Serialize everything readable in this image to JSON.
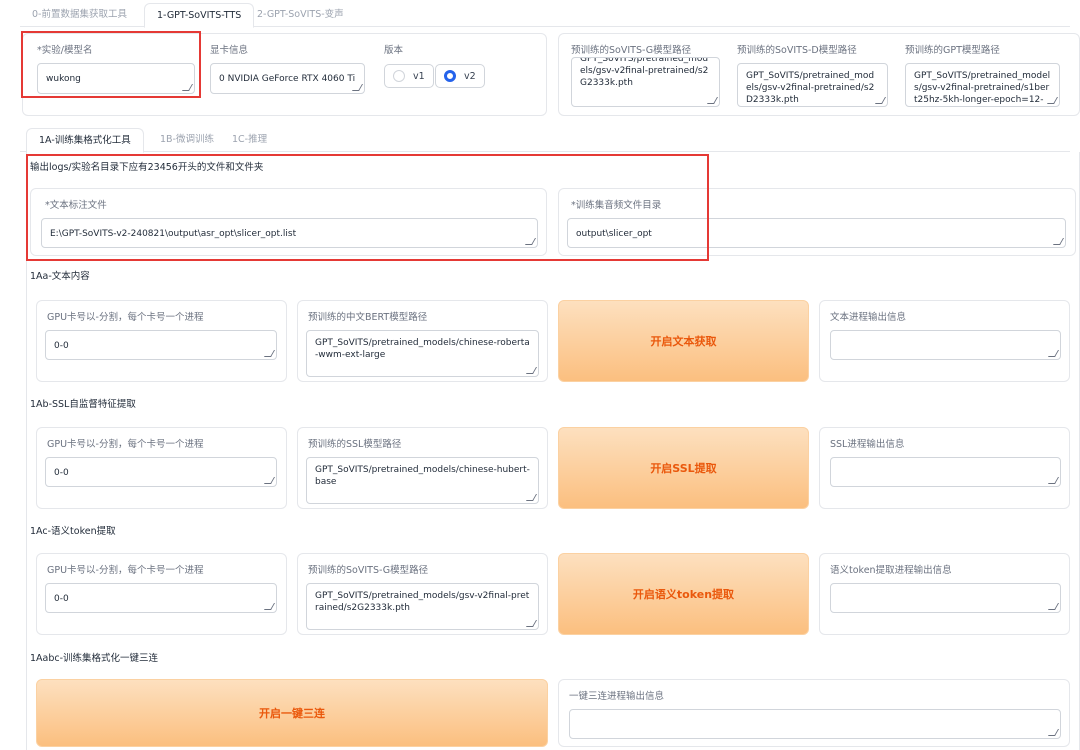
{
  "top_tabs": [
    "0-前置数据集获取工具",
    "1-GPT-SoVITS-TTS",
    "2-GPT-SoVITS-变声"
  ],
  "settings": {
    "exp_name_label": "*实验/模型名",
    "exp_name_value": "wukong",
    "gpu_info_label": "显卡信息",
    "gpu_info_value": "0 NVIDIA GeForce RTX 4060 Ti",
    "version_label": "版本",
    "version_options": [
      "v1",
      "v2"
    ],
    "version_selected": "v2",
    "sovits_g_label": "预训练的SoVITS-G模型路径",
    "sovits_g_value": "GPT_SoVITS/pretrained_models/gsv-v2final-pretrained/s2G2333k.pth",
    "sovits_d_label": "预训练的SoVITS-D模型路径",
    "sovits_d_value": "GPT_SoVITS/pretrained_models/gsv-v2final-pretrained/s2D2333k.pth",
    "gpt_label": "预训练的GPT模型路径",
    "gpt_value": "GPT_SoVITS/pretrained_models/gsv-v2final-pretrained/s1bert25hz-5kh-longer-epoch=12-"
  },
  "sub_tabs": [
    "1A-训练集格式化工具",
    "1B-微调训练",
    "1C-推理"
  ],
  "logs_hint": "输出logs/实验名目录下应有23456开头的文件和文件夹",
  "inputs": {
    "text_label": "*文本标注文件",
    "text_value": "E:\\GPT-SoVITS-v2-240821\\output\\asr_opt\\slicer_opt.list",
    "audio_dir_label": "*训练集音频文件目录",
    "audio_dir_value": "output\\slicer_opt"
  },
  "section_1aa": {
    "title": "1Aa-文本内容",
    "gpu_label": "GPU卡号以-分割，每个卡号一个进程",
    "gpu_value": "0-0",
    "bert_label": "预训练的中文BERT模型路径",
    "bert_value": "GPT_SoVITS/pretrained_models/chinese-roberta-wwm-ext-large",
    "button": "开启文本获取",
    "output_label": "文本进程输出信息",
    "output_value": ""
  },
  "section_1ab": {
    "title": "1Ab-SSL自监督特征提取",
    "gpu_label": "GPU卡号以-分割，每个卡号一个进程",
    "gpu_value": "0-0",
    "ssl_label": "预训练的SSL模型路径",
    "ssl_value": "GPT_SoVITS/pretrained_models/chinese-hubert-base",
    "button": "开启SSL提取",
    "output_label": "SSL进程输出信息",
    "output_value": ""
  },
  "section_1ac": {
    "title": "1Ac-语义token提取",
    "gpu_label": "GPU卡号以-分割，每个卡号一个进程",
    "gpu_value": "0-0",
    "model_label": "预训练的SoVITS-G模型路径",
    "model_value": "GPT_SoVITS/pretrained_models/gsv-v2final-pretrained/s2G2333k.pth",
    "button": "开启语义token提取",
    "output_label": "语义token提取进程输出信息",
    "output_value": ""
  },
  "section_1aabc": {
    "title": "1Aabc-训练集格式化一键三连",
    "button": "开启一键三连",
    "output_label": "一键三连进程输出信息",
    "output_value": ""
  },
  "colors": {
    "accent_blue": "#2563eb",
    "button_orange": "#ea580c",
    "highlight_red": "#e53935"
  }
}
